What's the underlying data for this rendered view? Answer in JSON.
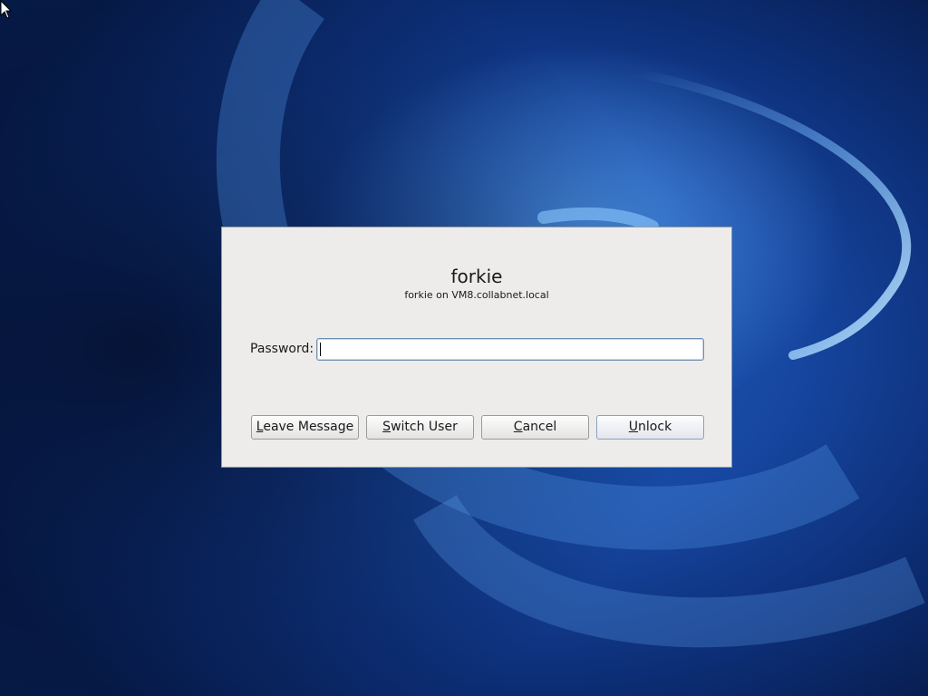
{
  "dialog": {
    "user_name": "forkie",
    "user_host": "forkie on VM8.collabnet.local",
    "password_label": "Password:",
    "password_value": "",
    "buttons": {
      "leave_message": {
        "mnemonic": "L",
        "rest": "eave Message"
      },
      "switch_user": {
        "mnemonic": "S",
        "rest": "witch User"
      },
      "cancel": {
        "mnemonic": "C",
        "rest": "ancel"
      },
      "unlock": {
        "mnemonic": "U",
        "rest": "nlock"
      }
    }
  },
  "icons": {
    "cursor": "arrow-cursor-icon"
  },
  "colors": {
    "dialog_bg": "#edecea",
    "desktop_blue": "#1646a0"
  }
}
